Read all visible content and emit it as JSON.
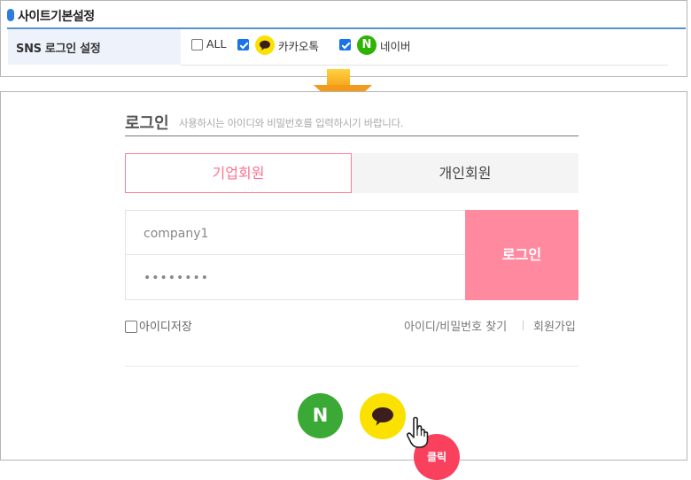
{
  "site_settings": {
    "title": "사이트기본설정",
    "sns_row": {
      "label": "SNS 로그인 설정",
      "options": [
        {
          "label": "ALL",
          "checked": false
        },
        {
          "label": "카카오톡",
          "checked": true,
          "icon": "kakao-chat-icon"
        },
        {
          "label": "네이버",
          "checked": true,
          "icon": "naver-icon",
          "icon_letter": "N"
        }
      ]
    }
  },
  "login": {
    "title": "로그인",
    "subtitle": "사용하시는 아이디와 비밀번호를 입력하시기 바랍니다.",
    "tabs": [
      {
        "label": "기업회원",
        "active": true
      },
      {
        "label": "개인회원",
        "active": false
      }
    ],
    "id_value": "company1",
    "password_value": "••••••••",
    "login_button": "로그인",
    "save_id_label": "아이디저장",
    "save_id_checked": false,
    "find_link": "아이디/비밀번호 찾기",
    "join_link": "회원가입",
    "social": {
      "naver_letter": "N"
    }
  },
  "annotation": {
    "click_label": "클릭"
  },
  "colors": {
    "accent_pink": "#ff8aa0",
    "naver_green": "#3ba935",
    "kakao_yellow": "#fae100",
    "click_red": "#f9415e",
    "arrow_orange": "#f39a1a",
    "checkbox_blue": "#1a73e8"
  }
}
